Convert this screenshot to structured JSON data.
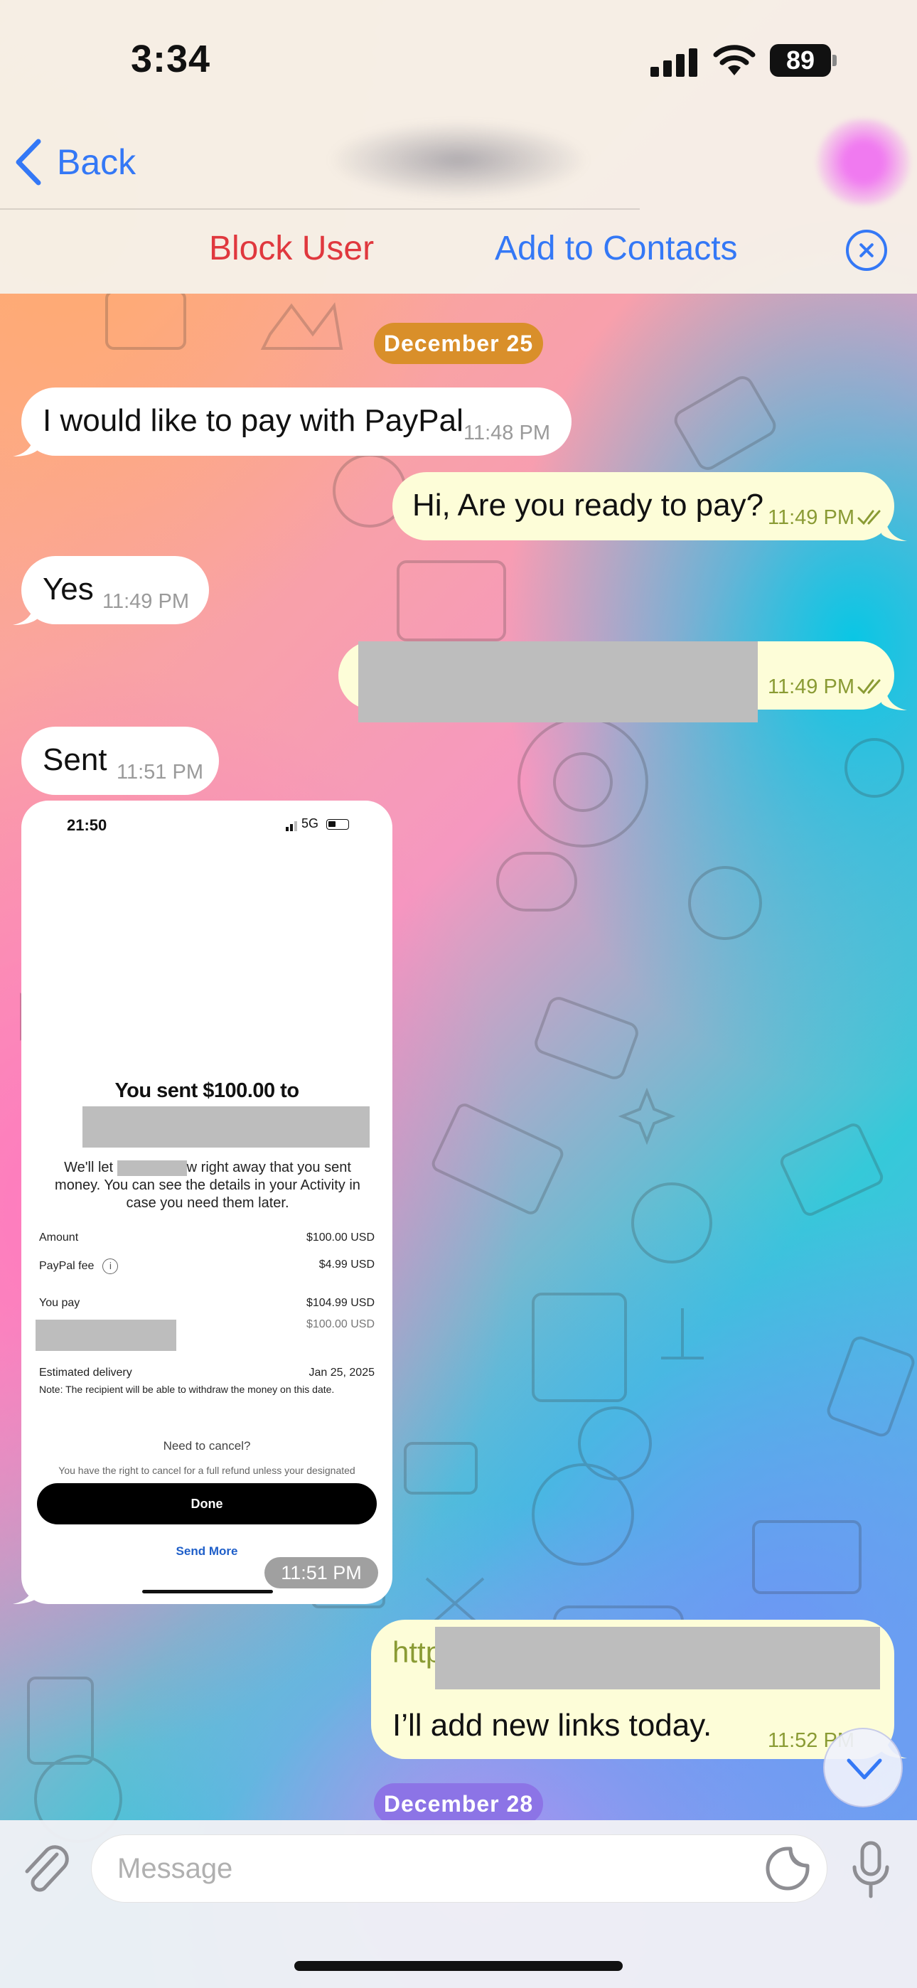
{
  "status_bar": {
    "time": "3:34",
    "battery": "89"
  },
  "header": {
    "back_label": "Back"
  },
  "banner": {
    "block_label": "Block User",
    "add_contacts_label": "Add to Contacts"
  },
  "dates": {
    "first": "December 25",
    "second": "December 28"
  },
  "colors": {
    "accent": "#3478f6",
    "danger": "#e0383e",
    "outgoing_bubble": "#fdfdd8",
    "incoming_bubble": "#ffffff",
    "date_pill_1": "#d98f2a",
    "date_pill_2": "#8c74e6"
  },
  "messages": [
    {
      "direction": "in",
      "text": "I would like to pay with PayPal",
      "time": "11:48 PM"
    },
    {
      "direction": "out",
      "text": "Hi, Are you ready to pay?",
      "time": "11:49 PM",
      "read": true
    },
    {
      "direction": "in",
      "text": "Yes",
      "time": "11:49 PM"
    },
    {
      "direction": "out",
      "text": "",
      "time": "11:49 PM",
      "read": true
    },
    {
      "direction": "in",
      "text": "Sent",
      "time": "11:51 PM"
    },
    {
      "direction": "in",
      "type": "image",
      "time": "11:51 PM"
    },
    {
      "direction": "out",
      "link": "http",
      "text": "I’ll add new links today.",
      "time": "11:52 PM"
    }
  ],
  "screenshot": {
    "time": "21:50",
    "status": "5G",
    "title": "You sent $100.00 to",
    "message_a": "We'll let",
    "message_b": "w right away that you sent money. You can see the details in your Activity in case you need them later.",
    "rows": [
      {
        "label": "Amount",
        "value": "$100.00 USD"
      },
      {
        "label": "PayPal fee",
        "value": "$4.99 USD"
      },
      {
        "label": "You pay",
        "value": "$104.99 USD",
        "sub_value": "$100.00 USD"
      },
      {
        "label": "Estimated delivery",
        "value": "Jan 25, 2025"
      }
    ],
    "note": "Note: The recipient will be able to withdraw the money on this date.",
    "cancel_title": "Need to cancel?",
    "cancel_text": "You have the right to cancel for a full refund unless your designated",
    "done_label": "Done",
    "send_more_label": "Send More"
  },
  "composer": {
    "placeholder": "Message"
  },
  "icons": [
    "chevron-left-icon",
    "close-circle-icon",
    "signal-icon",
    "wifi-icon",
    "battery-icon",
    "read-check-icon",
    "chevron-down-icon",
    "paperclip-icon",
    "sticker-icon",
    "microphone-icon",
    "info-icon"
  ]
}
